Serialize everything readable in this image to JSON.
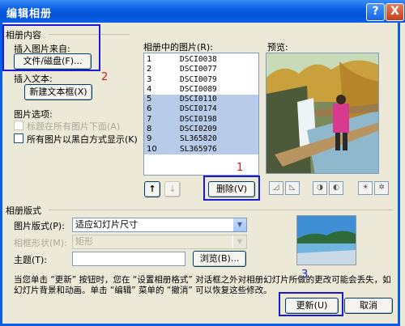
{
  "dialog": {
    "title": "编辑相册",
    "help_icon": "?",
    "close_icon": "X"
  },
  "album_content": {
    "group_label": "相册内容",
    "insert_from_label": "插入图片来自:",
    "file_disk_button": "文件/磁盘(F)...",
    "insert_text_label": "插入文本:",
    "new_textbox_button": "新建文本框(X)",
    "picture_options_label": "图片选项:",
    "caption_below_all": "标题在所有图片下面(A)",
    "all_black_white": "所有图片以黑白方式显示(K)"
  },
  "pictures_list": {
    "label": "相册中的图片(R):",
    "items": [
      {
        "num": "1",
        "name": "DSCI0038",
        "selected": false
      },
      {
        "num": "2",
        "name": "DSCI0077",
        "selected": false
      },
      {
        "num": "3",
        "name": "DSCI0079",
        "selected": false
      },
      {
        "num": "4",
        "name": "DSCI0089",
        "selected": false
      },
      {
        "num": "5",
        "name": "DSCI0110",
        "selected": true
      },
      {
        "num": "6",
        "name": "DSCI0174",
        "selected": true
      },
      {
        "num": "7",
        "name": "DSCI0198",
        "selected": true
      },
      {
        "num": "8",
        "name": "DSCI0209",
        "selected": true
      },
      {
        "num": "9",
        "name": "SL365820",
        "selected": true
      },
      {
        "num": "10",
        "name": "SL365976",
        "selected": true
      }
    ],
    "move_up_icon": "↑",
    "move_down_icon": "↓",
    "delete_button": "删除(V)"
  },
  "preview": {
    "label": "预览:"
  },
  "layout": {
    "group_label": "相册版式",
    "picture_layout_label": "图片版式(P):",
    "picture_layout_value": "适应幻灯片尺寸",
    "frame_shape_label": "相框形状(M):",
    "frame_shape_value": "矩形",
    "theme_label": "主题(T):",
    "theme_value": "",
    "browse_button": "浏览(B)..."
  },
  "note": "当您单击 “更新” 按钮时，您在 “设置相册格式” 对话框之外对相册幻灯片所做的更改可能会丢失，如幻灯片背景和动画。单击 “编辑” 菜单的 “撤消” 可以恢复这些修改。",
  "footer": {
    "update_button": "更新(U)",
    "cancel_button": "取消"
  },
  "annotations": {
    "n1": "1",
    "n2": "2",
    "n3": "3"
  }
}
